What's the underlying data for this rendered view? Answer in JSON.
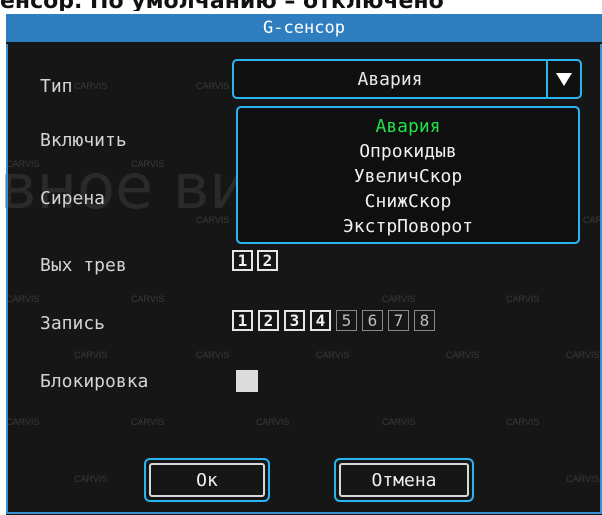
{
  "caption": "енсор. По умолчанию – отключено",
  "window": {
    "title": "G-сенсор"
  },
  "background_text": "вное видео набл",
  "watermark": "CARVIS",
  "fields": {
    "type_label": "Тип",
    "enable_label": "Включить",
    "siren_label": "Сирена",
    "alarm_out_label": "Вых трев",
    "record_label": "Запись",
    "lock_label": "Блокировка"
  },
  "type_select": {
    "value": "Авария",
    "options": [
      "Авария",
      "Опрокидыв",
      "УвеличСкор",
      "СнижСкор",
      "ЭкстрПоворот"
    ],
    "selected_index": 0
  },
  "alarm_out": [
    {
      "label": "1",
      "checked": true
    },
    {
      "label": "2",
      "checked": true
    }
  ],
  "record_channels": [
    {
      "label": "1",
      "checked": true
    },
    {
      "label": "2",
      "checked": true
    },
    {
      "label": "3",
      "checked": true
    },
    {
      "label": "4",
      "checked": true
    },
    {
      "label": "5",
      "checked": false
    },
    {
      "label": "6",
      "checked": false
    },
    {
      "label": "7",
      "checked": false
    },
    {
      "label": "8",
      "checked": false
    }
  ],
  "lock_checked": false,
  "buttons": {
    "ok": "Ок",
    "cancel": "Отмена"
  },
  "colors": {
    "accent": "#29b6f0",
    "title_bar": "#2f7fc0",
    "selected_option": "#22e04a",
    "panel_bg": "#161616"
  },
  "icons": {
    "dropdown_arrow": "triangle-down-icon"
  }
}
